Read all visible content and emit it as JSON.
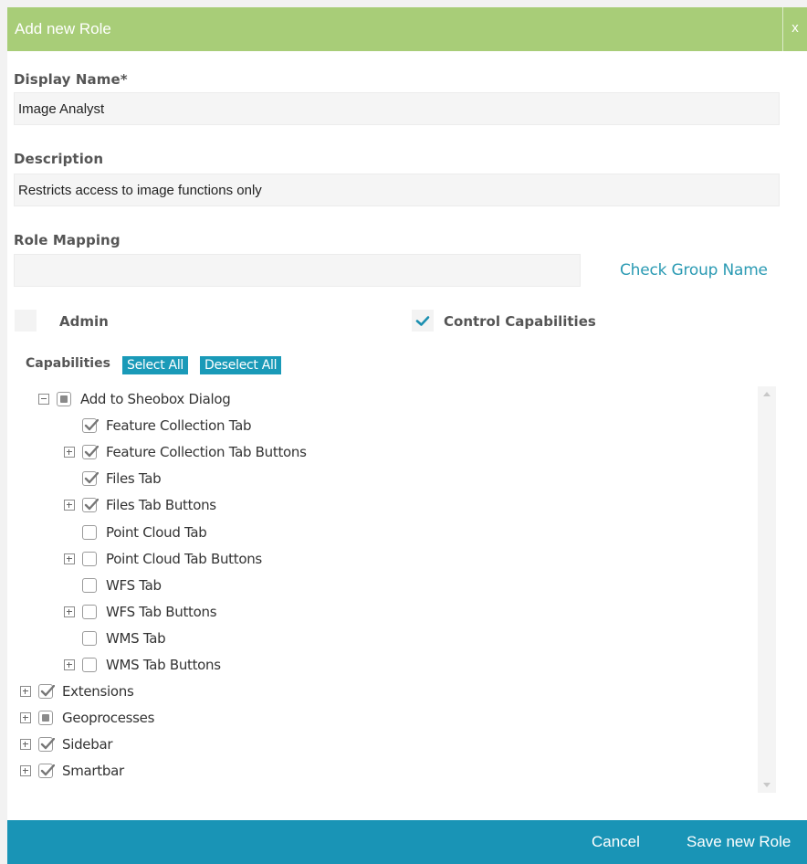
{
  "dialog": {
    "title": "Add new Role",
    "close_label": "x"
  },
  "form": {
    "display_name": {
      "label": "Display Name*",
      "value": "Image Analyst"
    },
    "description": {
      "label": "Description",
      "value": "Restricts access to image functions only"
    },
    "role_mapping": {
      "label": "Role Mapping",
      "value": "",
      "check_link": "Check Group Name"
    },
    "admin": {
      "label": "Admin",
      "checked": false
    },
    "control_capabilities": {
      "label": "Control Capabilities",
      "checked": true
    }
  },
  "capabilities": {
    "label": "Capabilities",
    "select_all": "Select All",
    "deselect_all": "Deselect All",
    "tree": [
      {
        "label": "Add to Sheobox Dialog",
        "level": 0,
        "expander": "minus",
        "state": "partial"
      },
      {
        "label": "Feature Collection Tab",
        "level": 1,
        "expander": "none",
        "state": "checked"
      },
      {
        "label": "Feature Collection Tab Buttons",
        "level": 1,
        "expander": "plus",
        "state": "checked"
      },
      {
        "label": "Files Tab",
        "level": 1,
        "expander": "none",
        "state": "checked"
      },
      {
        "label": "Files Tab Buttons",
        "level": 1,
        "expander": "plus",
        "state": "checked"
      },
      {
        "label": "Point Cloud Tab",
        "level": 1,
        "expander": "none",
        "state": "unchecked"
      },
      {
        "label": "Point Cloud Tab Buttons",
        "level": 1,
        "expander": "plus",
        "state": "unchecked"
      },
      {
        "label": "WFS Tab",
        "level": 1,
        "expander": "none",
        "state": "unchecked"
      },
      {
        "label": "WFS Tab Buttons",
        "level": 1,
        "expander": "plus",
        "state": "unchecked"
      },
      {
        "label": "WMS Tab",
        "level": 1,
        "expander": "none",
        "state": "unchecked"
      },
      {
        "label": "WMS Tab Buttons",
        "level": 1,
        "expander": "plus",
        "state": "unchecked"
      },
      {
        "label": "Extensions",
        "level": -1,
        "expander": "plus",
        "state": "checked"
      },
      {
        "label": "Geoprocesses",
        "level": -1,
        "expander": "plus",
        "state": "partial"
      },
      {
        "label": "Sidebar",
        "level": -1,
        "expander": "plus",
        "state": "checked"
      },
      {
        "label": "Smartbar",
        "level": -1,
        "expander": "plus",
        "state": "checked"
      }
    ]
  },
  "footer": {
    "cancel": "Cancel",
    "save": "Save new Role"
  },
  "colors": {
    "header": "#a8cd78",
    "accent": "#1a9ab8",
    "footer": "#1994b6",
    "link": "#2a9ab3"
  }
}
